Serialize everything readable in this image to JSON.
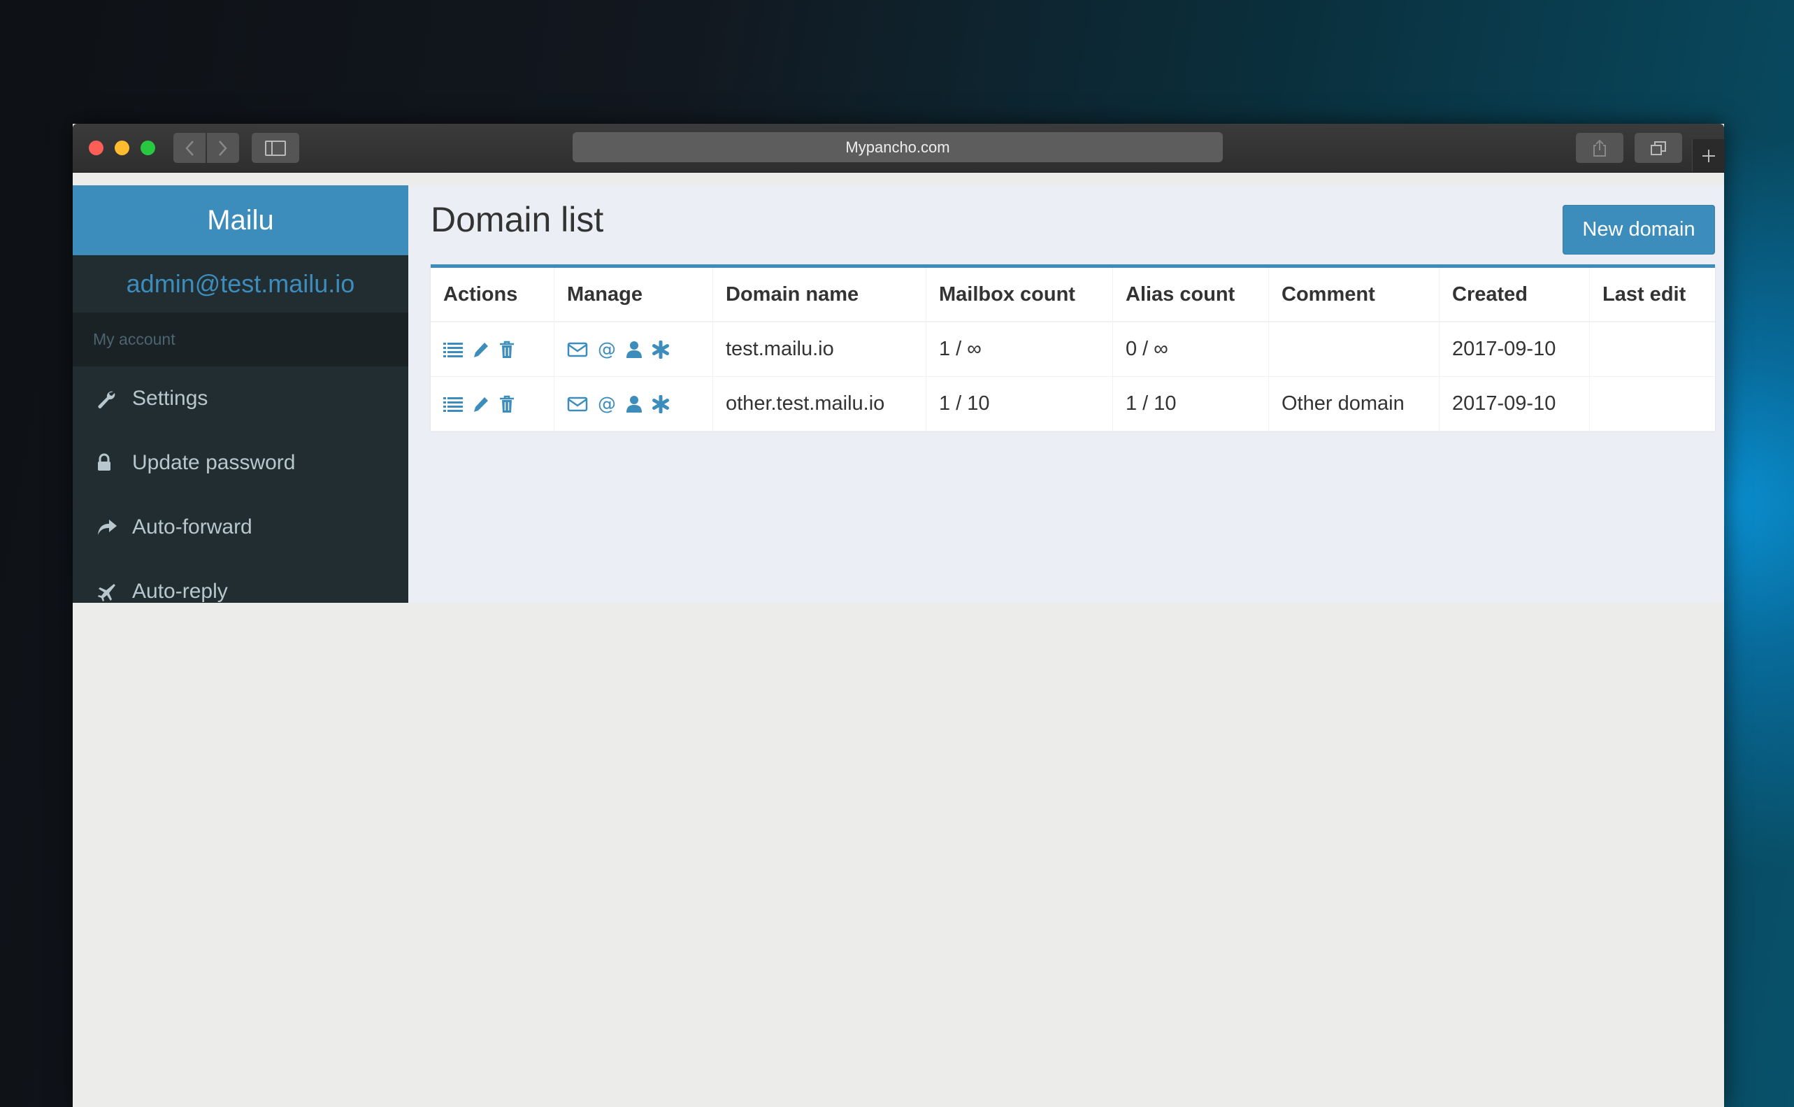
{
  "browser": {
    "url": "Mypancho.com"
  },
  "sidebar": {
    "brand": "Mailu",
    "user_email": "admin@test.mailu.io",
    "section_header": "My account",
    "items": [
      {
        "label": "Settings",
        "icon": "wrench-icon"
      },
      {
        "label": "Update password",
        "icon": "lock-icon"
      },
      {
        "label": "Auto-forward",
        "icon": "share-icon"
      },
      {
        "label": "Auto-reply",
        "icon": "plane-icon"
      }
    ]
  },
  "main": {
    "title": "Domain list",
    "new_button": "New domain",
    "table": {
      "headers": [
        "Actions",
        "Manage",
        "Domain name",
        "Mailbox count",
        "Alias count",
        "Comment",
        "Created",
        "Last edit"
      ],
      "rows": [
        {
          "domain": "test.mailu.io",
          "mailbox_count": "1 / ∞",
          "alias_count": "0 / ∞",
          "comment": "",
          "created": "2017-09-10",
          "last_edit": ""
        },
        {
          "domain": "other.test.mailu.io",
          "mailbox_count": "1 / 10",
          "alias_count": "1 / 10",
          "comment": "Other domain",
          "created": "2017-09-10",
          "last_edit": ""
        }
      ]
    }
  },
  "colors": {
    "accent": "#3c8dbc",
    "sidebar_bg": "#222d32",
    "sidebar_text": "#b8c7ce"
  }
}
